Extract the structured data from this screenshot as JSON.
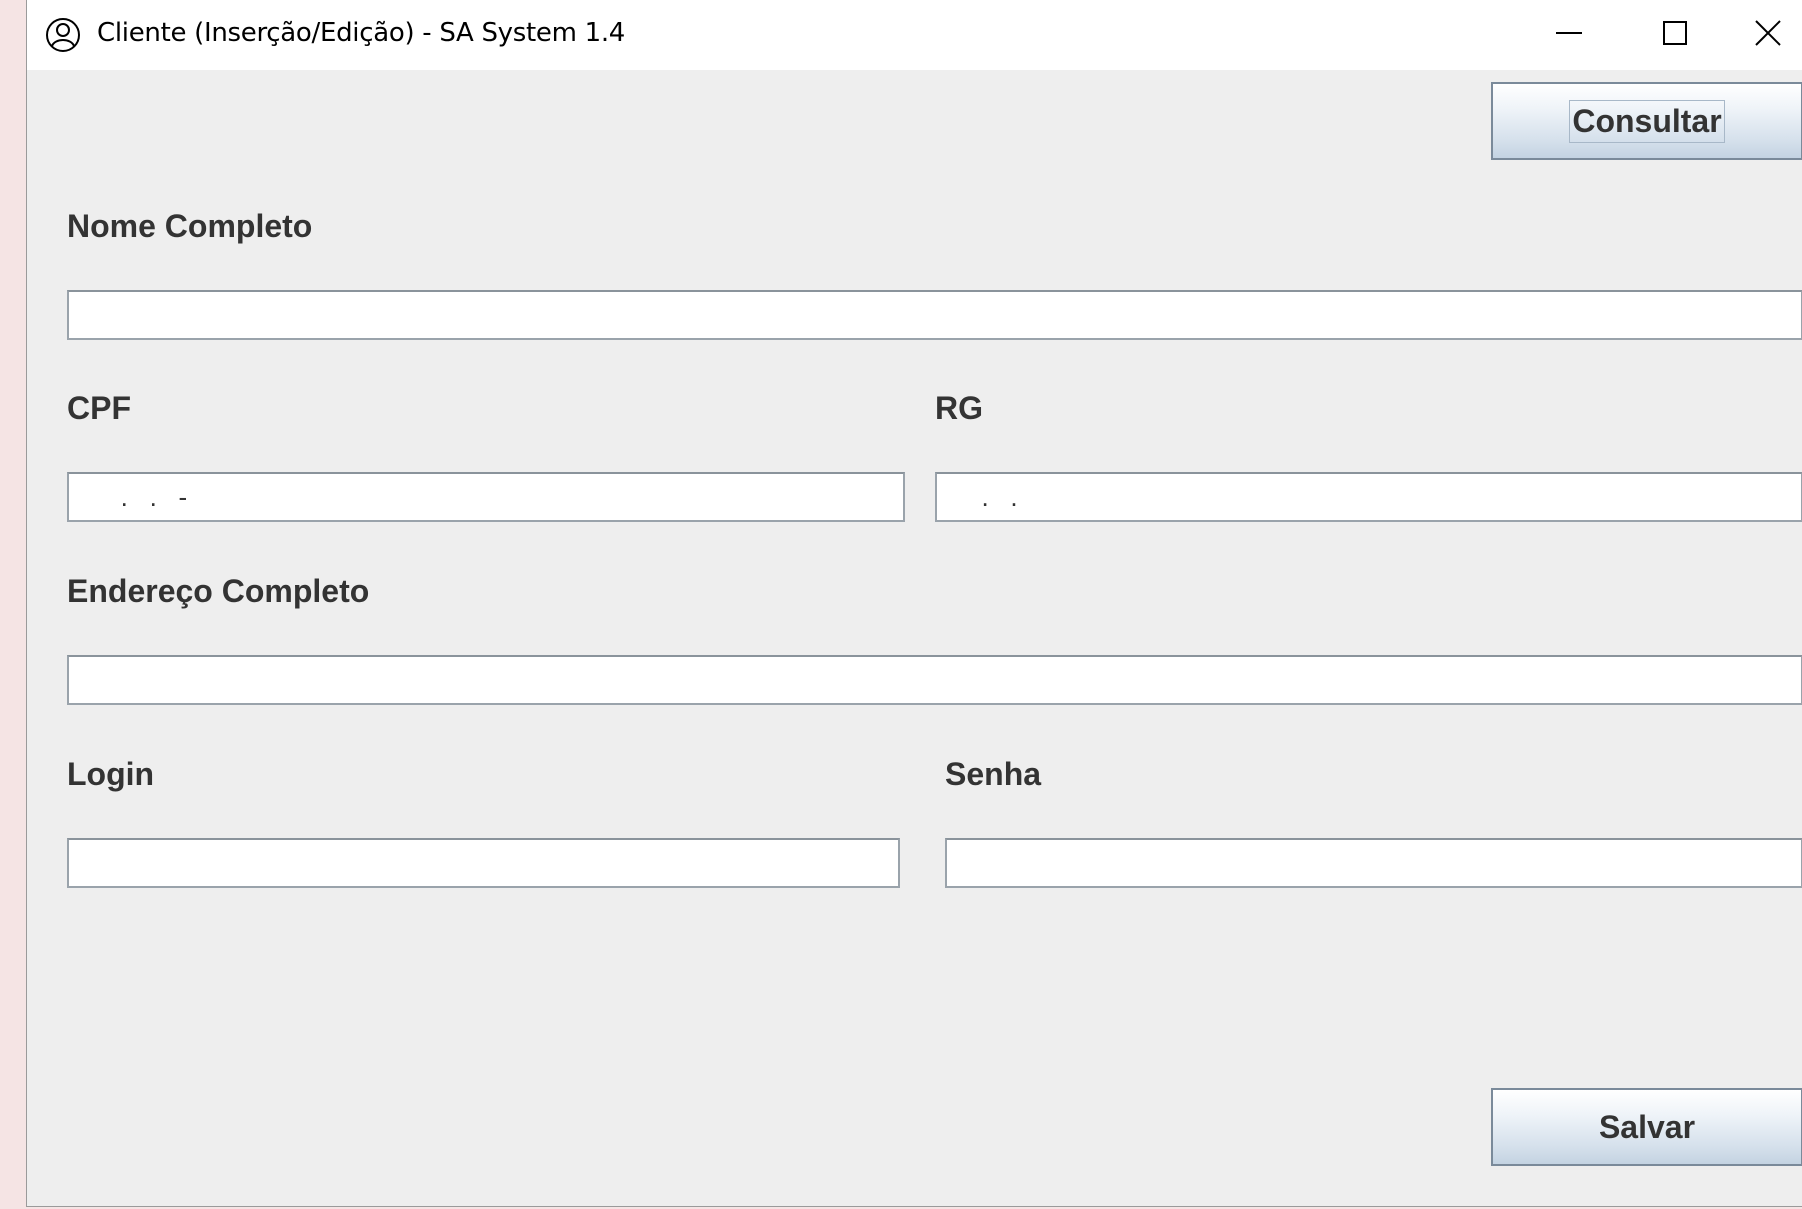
{
  "window": {
    "title": "Cliente (Inserção/Edição) - SA System 1.4"
  },
  "toolbar": {
    "consultar_label": "Consultar",
    "salvar_label": "Salvar"
  },
  "form": {
    "nome_label": "Nome Completo",
    "nome_value": "",
    "cpf_label": "CPF",
    "cpf_value": "   .   .   -  ",
    "rg_label": "RG",
    "rg_value": "  .   .   ",
    "endereco_label": "Endereço Completo",
    "endereco_value": "",
    "login_label": "Login",
    "login_value": "",
    "senha_label": "Senha",
    "senha_value": ""
  },
  "icons": {
    "app": "user-circle-icon",
    "minimize": "minimize-icon",
    "maximize": "maximize-icon",
    "close": "close-icon"
  }
}
